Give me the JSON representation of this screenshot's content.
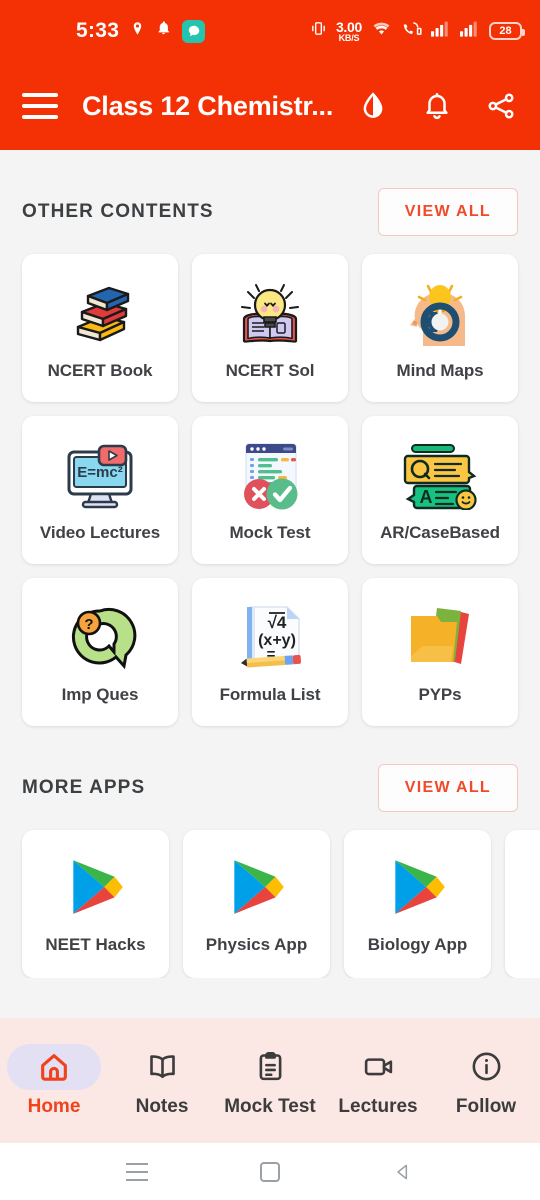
{
  "statusbar": {
    "time": "5:33",
    "location_icon": "location-pin-icon",
    "alarm_icon": "bell-icon",
    "chat_icon": "chat-bubble-icon",
    "vibrate_icon": "vibrate-icon",
    "net_speed_value": "3.00",
    "net_speed_unit": "KB/S",
    "wifi_icon": "wifi-icon",
    "call_icon": "phone-signal-icon",
    "signal1_icon": "signal-bars-icon",
    "signal2_icon": "signal-bars-icon",
    "battery_percent": "28"
  },
  "appbar": {
    "menu_icon": "hamburger-menu-icon",
    "title": "Class 12 Chemistr...",
    "contrast_icon": "contrast-droplet-icon",
    "notification_icon": "bell-icon",
    "share_icon": "share-icon",
    "background_color": "#f43005"
  },
  "other_contents": {
    "title": "OTHER CONTENTS",
    "view_all_label": "VIEW ALL",
    "accent_color": "#f04a2a",
    "items": [
      {
        "label": "NCERT Book",
        "icon": "books-stack-icon"
      },
      {
        "label": "NCERT Sol",
        "icon": "lightbulb-book-icon"
      },
      {
        "label": "Mind Maps",
        "icon": "head-gear-bulb-icon"
      },
      {
        "label": "Video Lectures",
        "icon": "monitor-play-icon"
      },
      {
        "label": "Mock Test",
        "icon": "test-check-cross-icon"
      },
      {
        "label": "AR/CaseBased",
        "icon": "qa-chat-bubbles-icon"
      },
      {
        "label": "Imp Ques",
        "icon": "question-q-icon"
      },
      {
        "label": "Formula List",
        "icon": "formula-sheet-pencil-icon"
      },
      {
        "label": "PYPs",
        "icon": "folders-icon"
      }
    ]
  },
  "more_apps": {
    "title": "MORE APPS",
    "view_all_label": "VIEW ALL",
    "items": [
      {
        "label": "NEET Hacks",
        "icon": "play-store-icon"
      },
      {
        "label": "Physics App",
        "icon": "play-store-icon"
      },
      {
        "label": "Biology App",
        "icon": "play-store-icon"
      },
      {
        "label": "",
        "icon": "play-store-icon"
      }
    ]
  },
  "bottom_nav": {
    "active_color": "#f0421b",
    "background_color": "#fbe8e5",
    "pill_color": "#e3e0f4",
    "items": [
      {
        "label": "Home",
        "icon": "home-icon",
        "active": true
      },
      {
        "label": "Notes",
        "icon": "book-open-icon",
        "active": false
      },
      {
        "label": "Mock Test",
        "icon": "clipboard-icon",
        "active": false
      },
      {
        "label": "Lectures",
        "icon": "video-camera-icon",
        "active": false
      },
      {
        "label": "Follow",
        "icon": "info-circle-icon",
        "active": false
      }
    ]
  },
  "system_nav": {
    "recents_icon": "recents-lines-icon",
    "home_icon": "home-square-icon",
    "back_icon": "back-triangle-icon"
  }
}
